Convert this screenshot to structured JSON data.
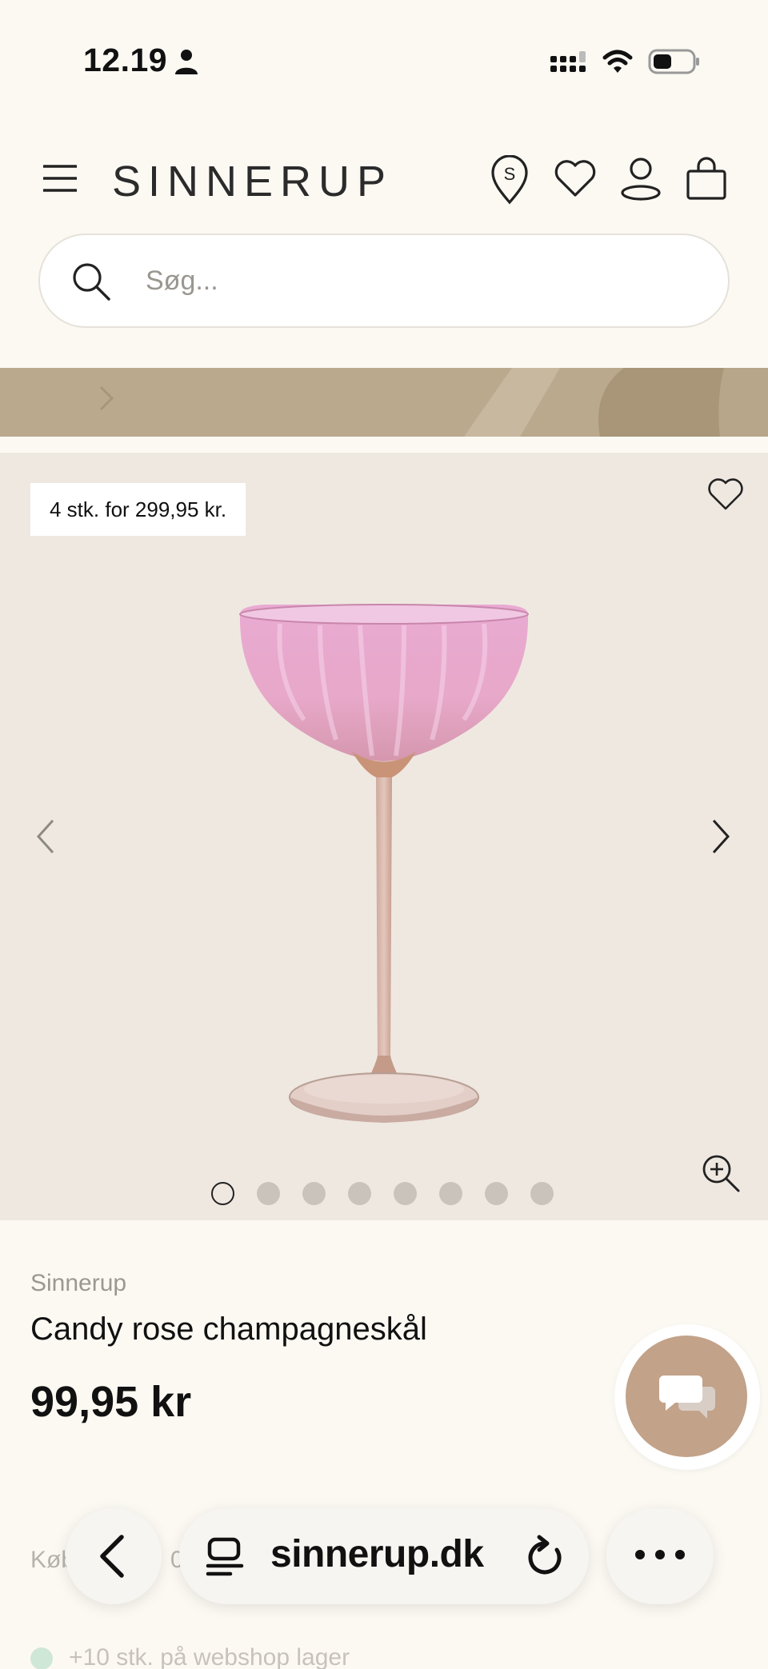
{
  "status_bar": {
    "time": "12.19",
    "icons": [
      "person-icon",
      "signal-icon",
      "wifi-icon",
      "battery-icon"
    ]
  },
  "header": {
    "logo": "SINNERUP",
    "icons": [
      "menu-icon",
      "store-locator-icon",
      "heart-icon",
      "account-icon",
      "shopping-bag-icon"
    ]
  },
  "search": {
    "placeholder": "Søg...",
    "value": ""
  },
  "banner": {
    "color": "#bba98e"
  },
  "gallery": {
    "badge": "4 stk. for 299,95 kr.",
    "image": "pink-champagne-coupe-glass",
    "slide_count": 8,
    "active_slide": 1
  },
  "product": {
    "brand": "Sinnerup",
    "title": "Candy rose champagneskål",
    "price": "99,95 kr",
    "buy_label": "Køb 4 for 299,95 kr... (partially hidden) Køb",
    "buy_label_visible": "Køb",
    "buy_label_suffix": "0",
    "stock": "+10 stk. på webshop lager"
  },
  "browser": {
    "url": "sinnerup.dk"
  },
  "colors": {
    "page_bg": "#fcf9f3",
    "gallery_bg": "#efe8e1",
    "banner": "#bba98e",
    "chat_button": "#c2a289",
    "stock_dot": "#cfe7d6"
  }
}
